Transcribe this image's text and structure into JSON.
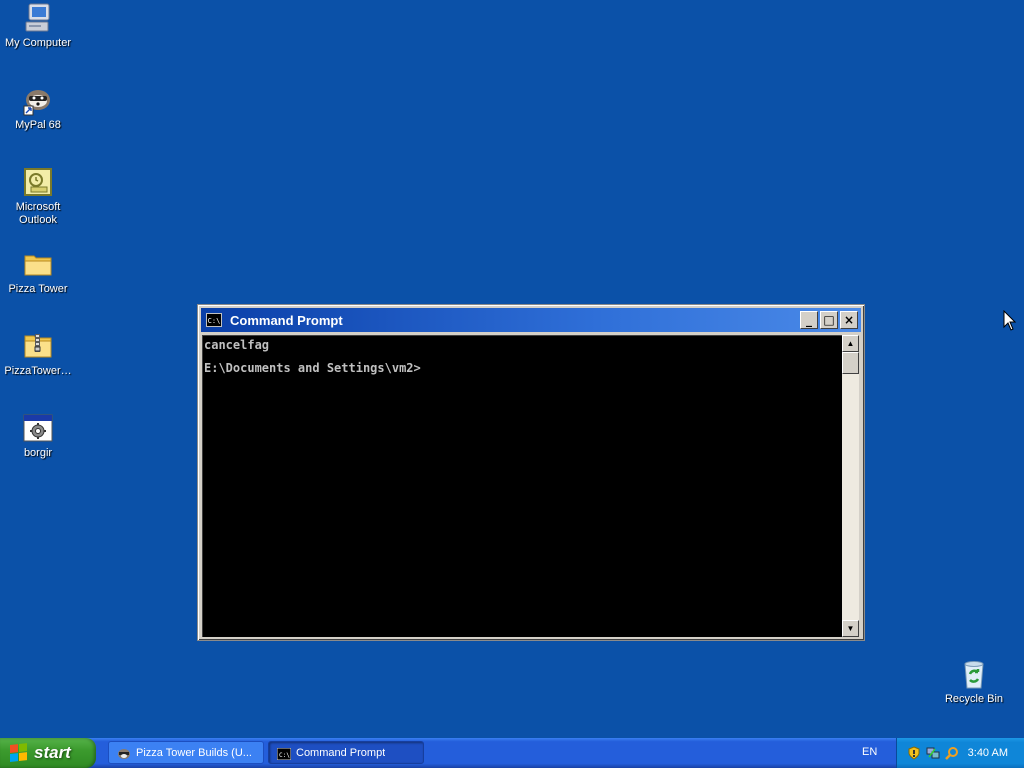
{
  "desktop": {
    "background_color": "#0b51a8",
    "icons": [
      {
        "label": "My Computer",
        "icon": "my-computer-icon"
      },
      {
        "label": "MyPal 68",
        "icon": "mypal-browser-icon"
      },
      {
        "label": "Microsoft\nOutlook",
        "icon": "outlook-icon"
      },
      {
        "label": "Pizza Tower",
        "icon": "folder-icon"
      },
      {
        "label": "PizzaTower…",
        "icon": "zip-folder-icon"
      },
      {
        "label": "borgir",
        "icon": "program-icon"
      },
      {
        "label": "Recycle Bin",
        "icon": "recycle-bin-icon"
      }
    ]
  },
  "cmd_window": {
    "title": "Command Prompt",
    "app_icon_text": "C:\\",
    "minimize": "_",
    "maximize": "□",
    "close": "×",
    "lines": [
      "cancelfag",
      "E:\\Documents and Settings\\vm2>"
    ],
    "scroll_up": "▲",
    "scroll_down": "▼"
  },
  "taskbar": {
    "start_label": "start",
    "buttons": [
      {
        "label": "Pizza Tower Builds (U...",
        "active": false
      },
      {
        "label": "Command Prompt",
        "active": true
      }
    ],
    "language": "EN",
    "clock": "3:40 AM"
  }
}
